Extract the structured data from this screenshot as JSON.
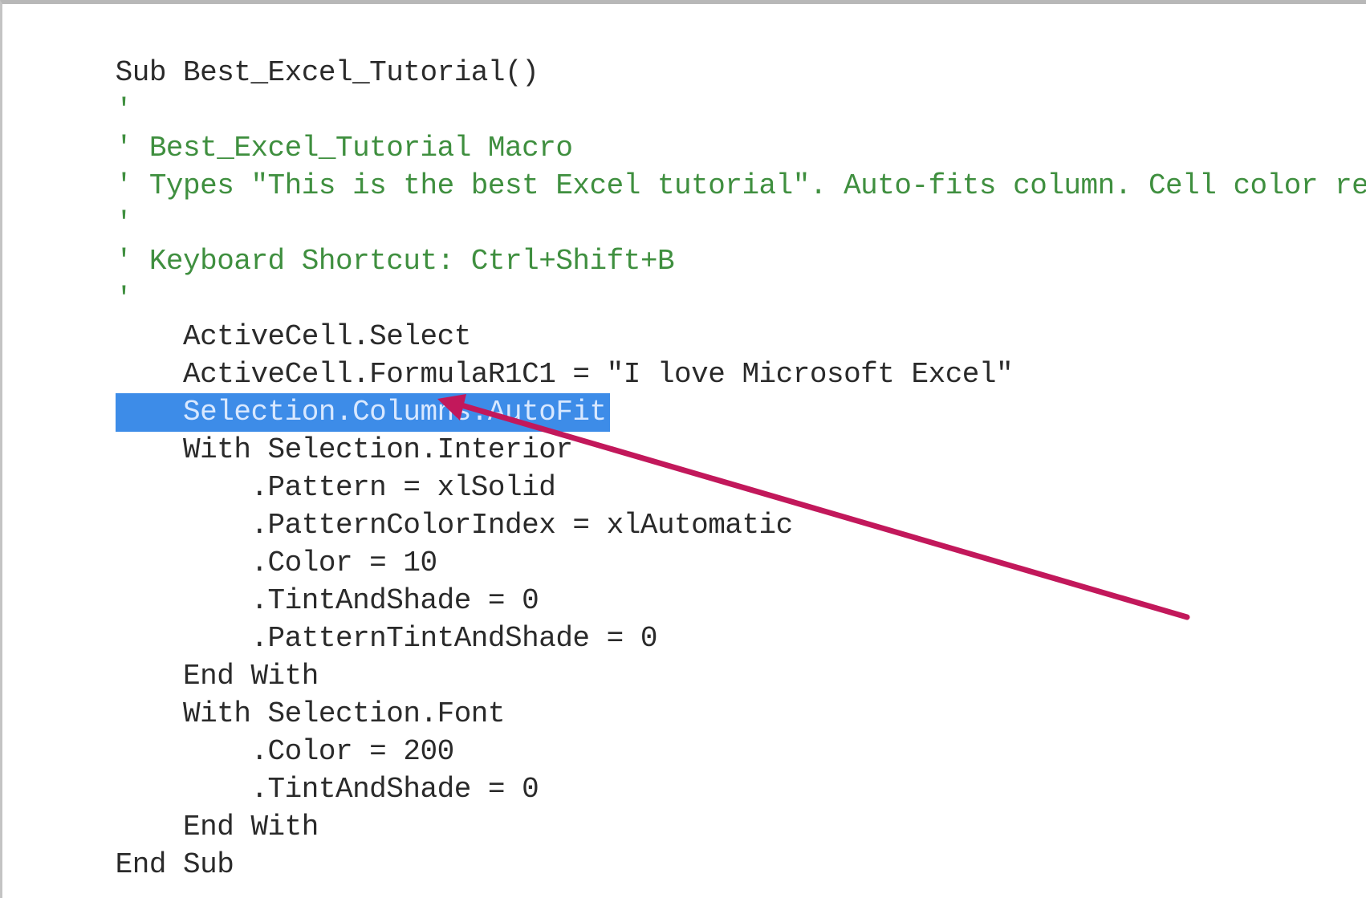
{
  "editor": {
    "lines": [
      {
        "text": "Sub Best_Excel_Tutorial()",
        "type": "code"
      },
      {
        "text": "'",
        "type": "comment"
      },
      {
        "text": "' Best_Excel_Tutorial Macro",
        "type": "comment"
      },
      {
        "text": "' Types \"This is the best Excel tutorial\". Auto-fits column. Cell color red. Font color blue.",
        "type": "comment"
      },
      {
        "text": "'",
        "type": "comment"
      },
      {
        "text": "' Keyboard Shortcut: Ctrl+Shift+B",
        "type": "comment"
      },
      {
        "text": "'",
        "type": "comment"
      },
      {
        "text": "    ActiveCell.Select",
        "type": "code"
      },
      {
        "text": "    ActiveCell.FormulaR1C1 = \"I love Microsoft Excel\"",
        "type": "code"
      },
      {
        "text": "    Selection.Columns.AutoFit",
        "type": "selected"
      },
      {
        "text": "    With Selection.Interior",
        "type": "code"
      },
      {
        "text": "        .Pattern = xlSolid",
        "type": "code"
      },
      {
        "text": "        .PatternColorIndex = xlAutomatic",
        "type": "code"
      },
      {
        "text": "        .Color = 10",
        "type": "code"
      },
      {
        "text": "        .TintAndShade = 0",
        "type": "code"
      },
      {
        "text": "        .PatternTintAndShade = 0",
        "type": "code"
      },
      {
        "text": "    End With",
        "type": "code"
      },
      {
        "text": "    With Selection.Font",
        "type": "code"
      },
      {
        "text": "        .Color = 200",
        "type": "code"
      },
      {
        "text": "        .TintAndShade = 0",
        "type": "code"
      },
      {
        "text": "    End With",
        "type": "code"
      },
      {
        "text": "End Sub",
        "type": "code"
      }
    ]
  },
  "colors": {
    "code": "#2a2a2a",
    "comment": "#3f8f3f",
    "selection_background": "#3d8ce8",
    "selection_text": "#d8e8ff",
    "arrow": "#c2185b"
  },
  "annotation": {
    "icon": "arrow-pointer-icon"
  }
}
